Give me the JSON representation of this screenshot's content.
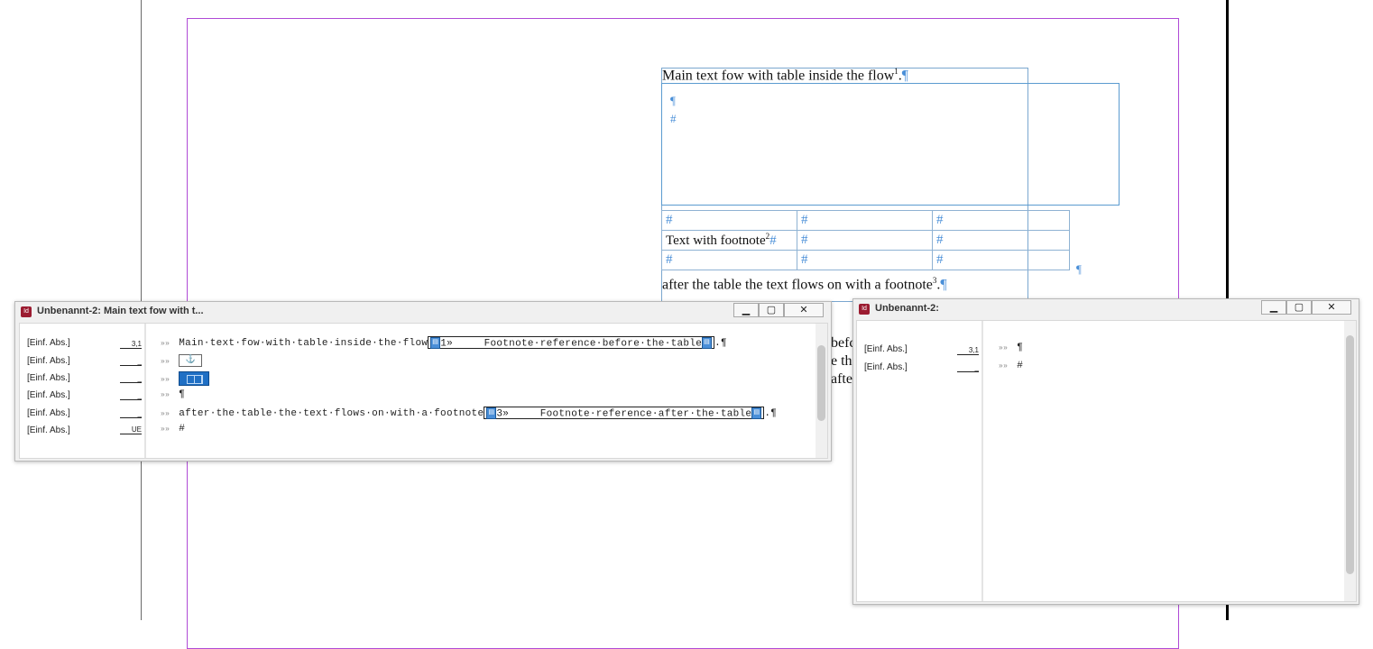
{
  "document": {
    "main_text_line1": "Main text fow with table inside the flow",
    "fn_ref_1": "1",
    "main_text_line1_end": ".",
    "pilcrow": "¶",
    "hash": "#",
    "table_cell_text": "Text with footnote",
    "fn_ref_2": "2",
    "after_text": "after the table the text flows on with a footnote",
    "fn_ref_3": "3",
    "after_text_end": ".",
    "peek_1": "befc",
    "peek_2": "e th",
    "peek_3": "afte"
  },
  "story_editor_main": {
    "title": "Unbenannt-2: Main text fow with t...",
    "controls": {
      "minimize": "▁",
      "maximize": "▢",
      "close": "✕"
    },
    "styles": [
      {
        "name": "[Einf. Abs.]",
        "depth": "3,1"
      },
      {
        "name": "[Einf. Abs.]",
        "depth": "_"
      },
      {
        "name": "[Einf. Abs.]",
        "depth": "_"
      },
      {
        "name": "[Einf. Abs.]",
        "depth": "_"
      },
      {
        "name": "[Einf. Abs.]",
        "depth": "_"
      },
      {
        "name": "[Einf. Abs.]",
        "depth": "UE"
      }
    ],
    "gutter": "»»",
    "line1_text": "Main·text·fow·with·table·inside·the·flow",
    "footnote1_num": "1»",
    "footnote1_text": "Footnote·reference·before·the·table",
    "line1_end": ".¶",
    "line4": "¶",
    "line5_text": "after·the·table·the·text·flows·on·with·a·footnote",
    "footnote3_num": "3»",
    "footnote3_text": "Footnote·reference·after·the·table",
    "line5_end": ".¶",
    "line6": "#"
  },
  "story_editor_second": {
    "title": "Unbenannt-2:",
    "controls": {
      "minimize": "▁",
      "maximize": "▢",
      "close": "✕"
    },
    "styles": [
      {
        "name": "[Einf. Abs.]",
        "depth": "3,1"
      },
      {
        "name": "[Einf. Abs.]",
        "depth": "_"
      }
    ],
    "gutter": "»»",
    "line1": "¶",
    "line2": "#"
  }
}
